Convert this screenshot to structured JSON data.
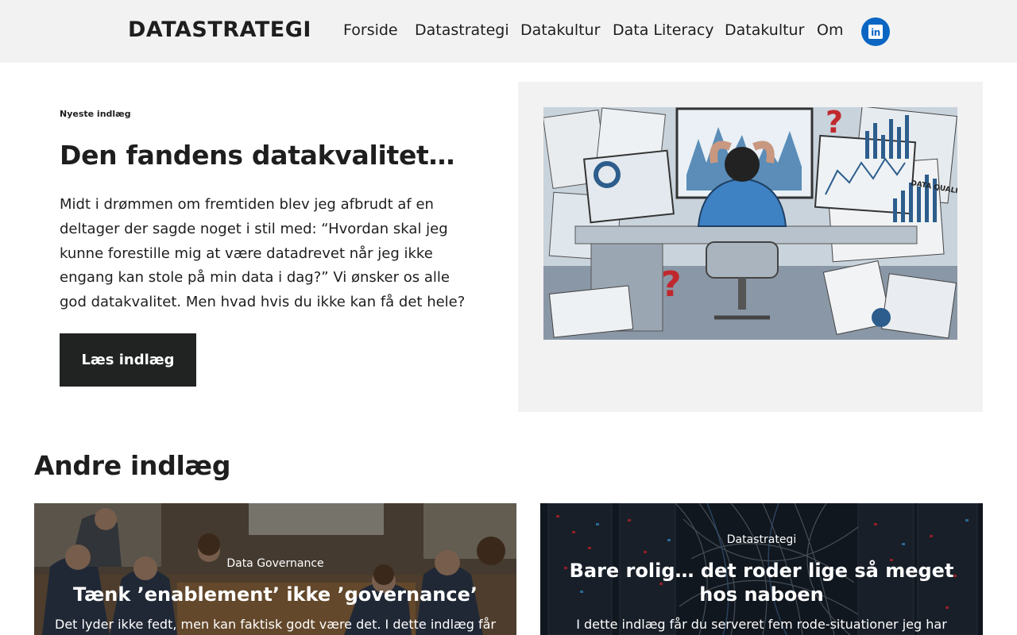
{
  "header": {
    "logo": "DATASTRATEGI",
    "nav": [
      {
        "label": "Forside"
      },
      {
        "label": "Datastrategi"
      },
      {
        "label": "Datakultur"
      },
      {
        "label": "Data Literacy"
      },
      {
        "label": "Datakultur"
      },
      {
        "label": "Om"
      }
    ],
    "social_icon": "linkedin-icon",
    "social_color": "#0a66c2",
    "social_glyph": "in"
  },
  "hero": {
    "label": "Nyeste indlæg",
    "title": "Den fandens datakvalitet…",
    "text": "Midt i drømmen om fremtiden blev jeg afbrudt af en deltager der sagde noget i stil med: “Hvordan skal jeg kunne forestille mig at være datadrevet når jeg ikke engang kan stole på min data i dag?” Vi ønsker os alle god datakvalitet. Men hvad hvis du ikke kan få det hele?",
    "button": "Læs indlæg",
    "image_labels": {
      "data_quality": "DATA QUALITY",
      "question": "?"
    }
  },
  "other": {
    "title": "Andre indlæg",
    "cards": [
      {
        "category": "Data Governance",
        "title": "Tænk ’enablement’ ikke ’governance’",
        "excerpt": "Det lyder ikke fedt, men kan faktisk godt være det. I dette indlæg får"
      },
      {
        "category": "Datastrategi",
        "title": "Bare rolig… det roder lige så meget hos naboen",
        "excerpt": "I dette indlæg får du serveret fem rode-situationer jeg har"
      }
    ]
  },
  "colors": {
    "header_bg": "#f2f2f2",
    "button_bg": "#212322",
    "text": "#1e1e1e",
    "panel_bg": "#f2f2f2"
  }
}
